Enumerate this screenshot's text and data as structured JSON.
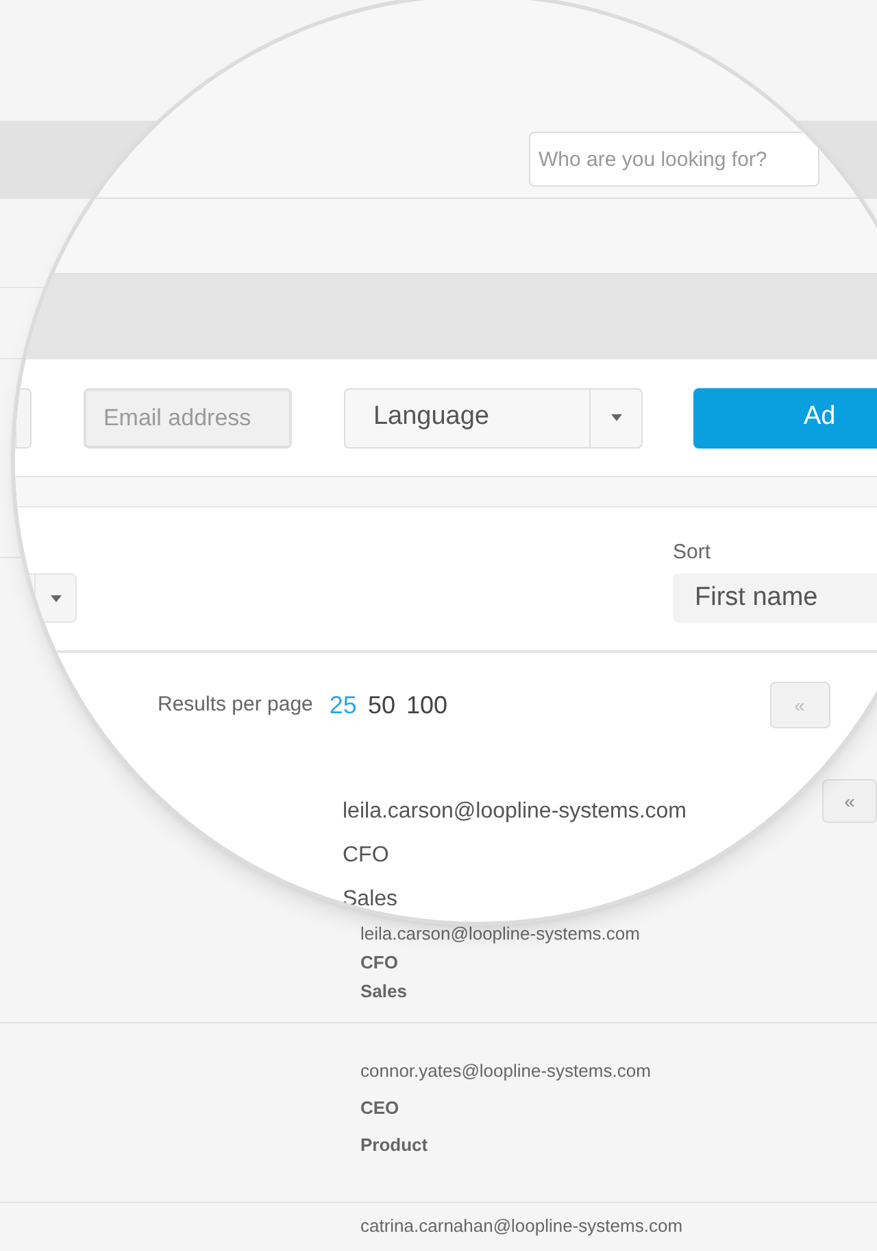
{
  "search": {
    "placeholder": "Who are you looking for?"
  },
  "form": {
    "email": {
      "placeholder": "Email address",
      "disabled": true
    },
    "language": {
      "value": "Language"
    },
    "add_button": "Ad"
  },
  "filters": {
    "sort_label": "Sort",
    "sort_value": "First name"
  },
  "results_per_page": {
    "label": "Results per page",
    "options": [
      {
        "label": "25",
        "selected": true
      },
      {
        "label": "50",
        "selected": false
      },
      {
        "label": "100",
        "selected": false
      }
    ]
  },
  "pagination": {
    "first": "«"
  },
  "magnified_person": {
    "email": "leila.carson@loopline-systems.com",
    "title": "CFO",
    "department": "Sales"
  },
  "background": {
    "pagination_first": "«",
    "people": [
      {
        "email": "leila.carson@loopline-systems.com",
        "title": "CFO",
        "department": "Sales"
      },
      {
        "email": "connor.yates@loopline-systems.com",
        "title": "CEO",
        "department": "Product"
      },
      {
        "email": "catrina.carnahan@loopline-systems.com"
      }
    ]
  }
}
